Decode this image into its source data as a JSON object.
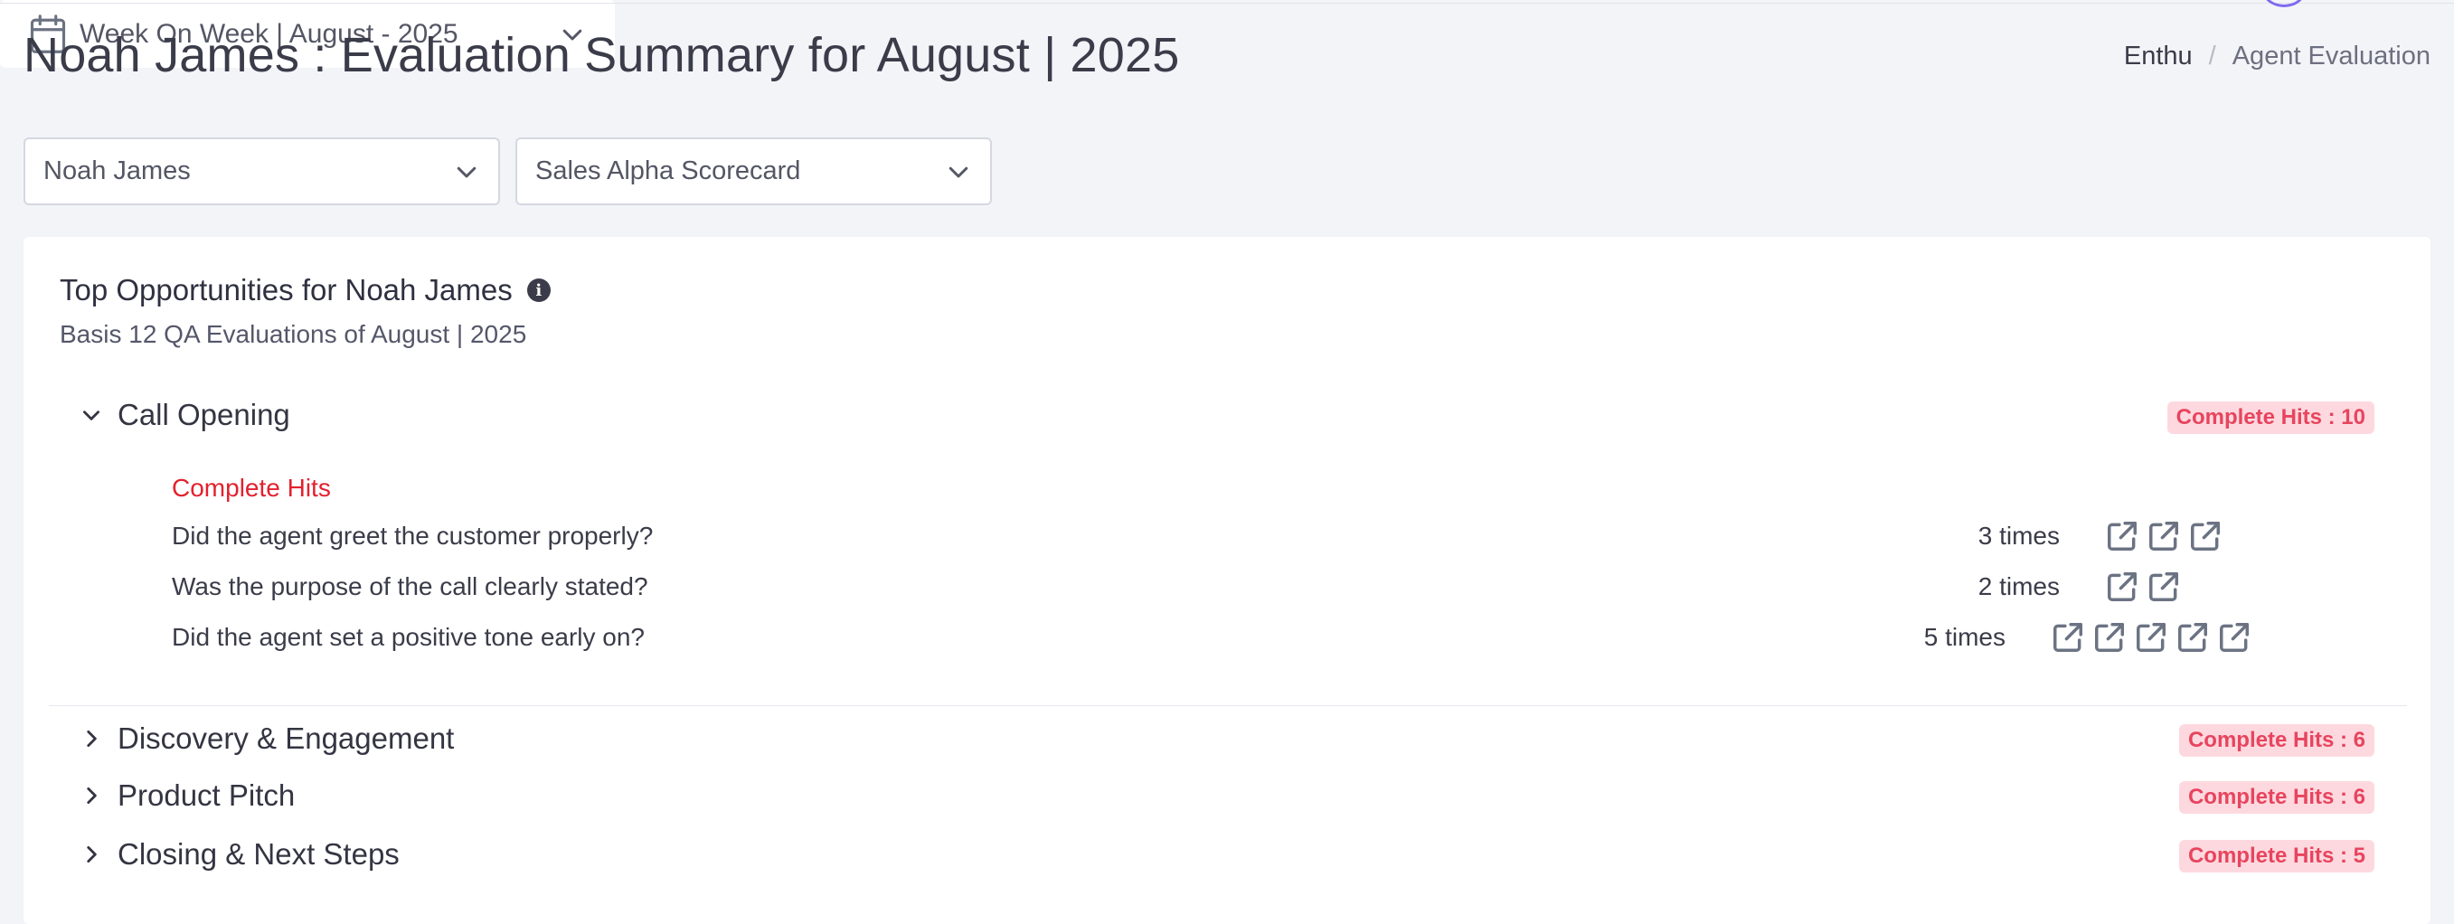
{
  "header": {
    "title": "Noah James : Evaluation Summary for August | 2025",
    "breadcrumb": {
      "root": "Enthu",
      "separator": "/",
      "current": "Agent Evaluation"
    }
  },
  "filters": {
    "agent": "Noah James",
    "scorecard": "Sales Alpha Scorecard",
    "date_range": "Week On Week | August - 2025"
  },
  "card": {
    "title": "Top Opportunities for Noah James",
    "subtitle": "Basis 12 QA Evaluations of August | 2025"
  },
  "sections": [
    {
      "name": "Call Opening",
      "badge": "Complete Hits : 10",
      "expanded": true,
      "hits_label": "Complete Hits",
      "questions": [
        {
          "text": "Did the agent greet the customer properly?",
          "count": "3 times",
          "links": 3
        },
        {
          "text": "Was the purpose of the call clearly stated?",
          "count": "2 times",
          "links": 2
        },
        {
          "text": "Did the agent set a positive tone early on?",
          "count": "5 times",
          "links": 5
        }
      ]
    },
    {
      "name": "Discovery & Engagement",
      "badge": "Complete Hits : 6",
      "expanded": false
    },
    {
      "name": "Product Pitch",
      "badge": "Complete Hits : 6",
      "expanded": false
    },
    {
      "name": "Closing & Next Steps",
      "badge": "Complete Hits : 5",
      "expanded": false
    }
  ],
  "colors": {
    "badge_bg": "#fdd9df",
    "badge_text": "#e8445e",
    "hits_heading": "#e3212e",
    "icon": "#6b7383"
  },
  "icons": {
    "link": "external-link-icon",
    "calendar": "calendar-icon",
    "info": "info-icon"
  }
}
